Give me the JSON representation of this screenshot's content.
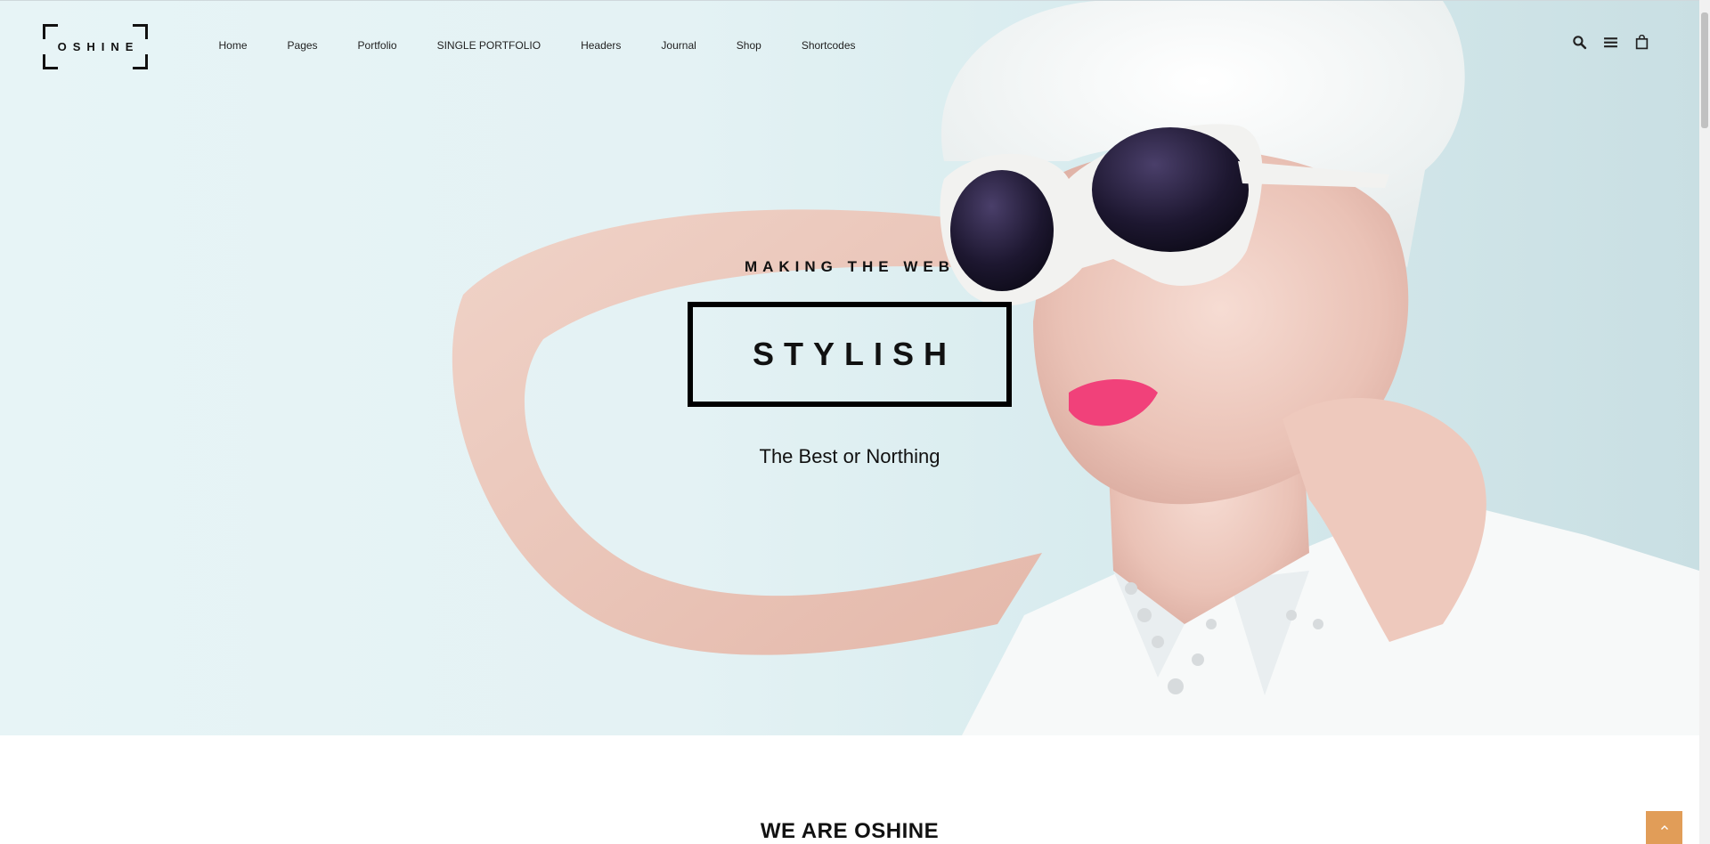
{
  "logo": {
    "text": "OSHINE"
  },
  "nav": {
    "items": [
      {
        "label": "Home"
      },
      {
        "label": "Pages"
      },
      {
        "label": "Portfolio"
      },
      {
        "label": "SINGLE PORTFOLIO"
      },
      {
        "label": "Headers"
      },
      {
        "label": "Journal"
      },
      {
        "label": "Shop"
      },
      {
        "label": "Shortcodes"
      }
    ]
  },
  "header_icons": [
    "search-icon",
    "menu-icon",
    "shopping-bag-icon"
  ],
  "hero": {
    "eyebrow": "MAKING THE WEB",
    "boxed_word": "STYLISH",
    "tagline": "The Best or Northing"
  },
  "section": {
    "title": "WE ARE OSHINE"
  },
  "back_to_top": {
    "icon": "chevron-up-icon",
    "color": "#e19d58"
  },
  "colors": {
    "accent": "#e19d58",
    "hero_background": "#e4f2f4",
    "text": "#111111"
  }
}
